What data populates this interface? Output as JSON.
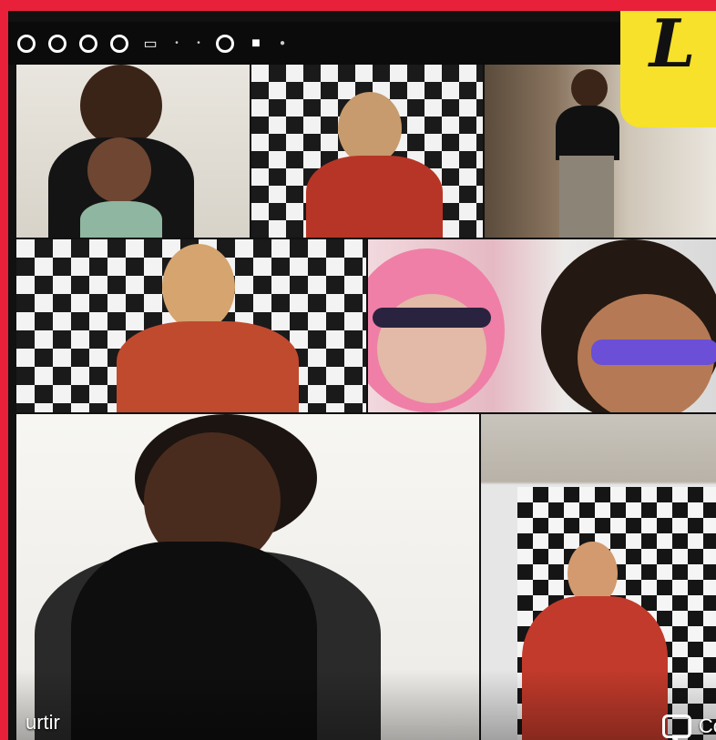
{
  "toolbar": {
    "icons": [
      "circle-icon",
      "circle-icon",
      "circle-icon",
      "circle-icon",
      "monitor-icon",
      "small-dot",
      "small-dot",
      "circle-icon",
      "camera-icon",
      "dot"
    ]
  },
  "badge": {
    "text": "L"
  },
  "footer": {
    "left_label": "urtir",
    "right_label": "Co"
  },
  "colors": {
    "border": "#e8203a",
    "badge": "#f7e12a",
    "toolbar": "#0b0b0b"
  }
}
